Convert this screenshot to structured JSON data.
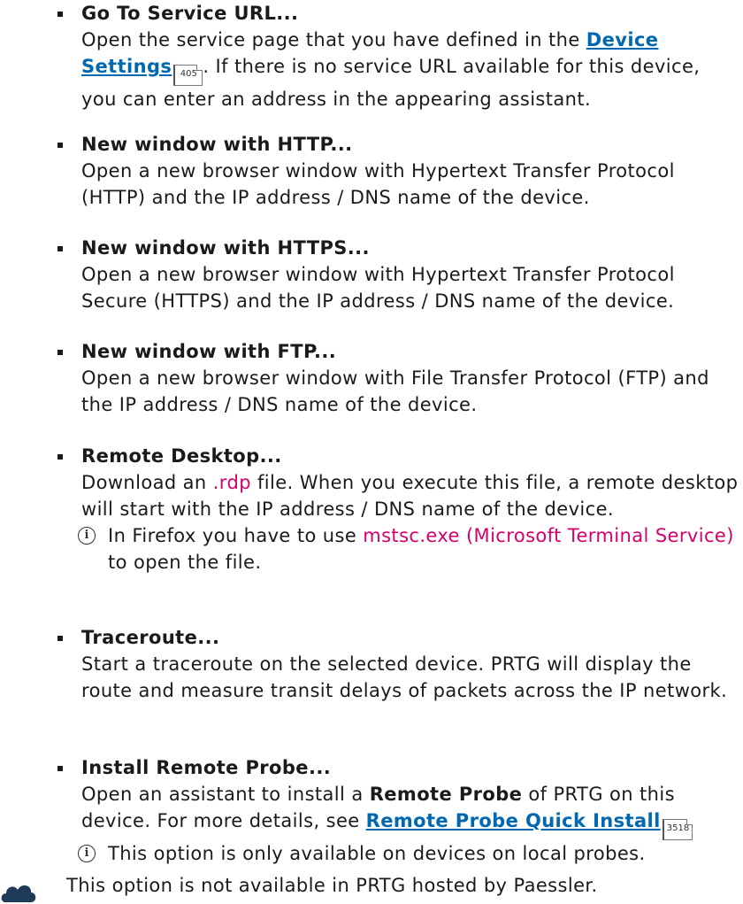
{
  "items": [
    {
      "title": "Go To Service URL...",
      "desc_before": "Open the service page that you have defined in the ",
      "link": "Device Settings",
      "ref": "405",
      "desc_after": ". If there is no service URL available for this device, you can enter an address in the appearing assistant."
    },
    {
      "title": "New window with HTTP...",
      "desc": "Open a new browser window with Hypertext Transfer Protocol (HTTP) and the IP address / DNS name of the device."
    },
    {
      "title": "New window with HTTPS...",
      "desc": "Open a new browser window with Hypertext Transfer Protocol Secure (HTTPS) and the IP address / DNS name of the device."
    },
    {
      "title": "New window with FTP...",
      "desc": "Open a new browser window with File Transfer Protocol (FTP) and the IP address / DNS name of the device."
    },
    {
      "title": "Remote Desktop...",
      "desc_before": "Download an ",
      "highlight": ".rdp",
      "desc_after": " file. When you execute this file, a remote desktop will start with the IP address / DNS name of the device.",
      "note_before": "In Firefox you have to use ",
      "note_highlight": "mstsc.exe (Microsoft Terminal Service)",
      "note_after": " to open the file."
    },
    {
      "title": "Traceroute...",
      "desc": "Start a traceroute on the selected device. PRTG will display the route and measure transit delays of packets across the IP network."
    },
    {
      "title": "Install Remote Probe...",
      "desc_before": "Open an assistant to install a ",
      "bold": "Remote Probe",
      "desc_middle": " of PRTG on this device. For more details, see ",
      "link": "Remote Probe Quick Install",
      "ref": "3518",
      "note": "This option is only available on devices on local probes."
    }
  ],
  "footer_note": "This option is not available in PRTG hosted by Paessler.",
  "colors": {
    "link": "#0068b0",
    "highlight": "#d6006d",
    "text": "#1a1a1a"
  }
}
